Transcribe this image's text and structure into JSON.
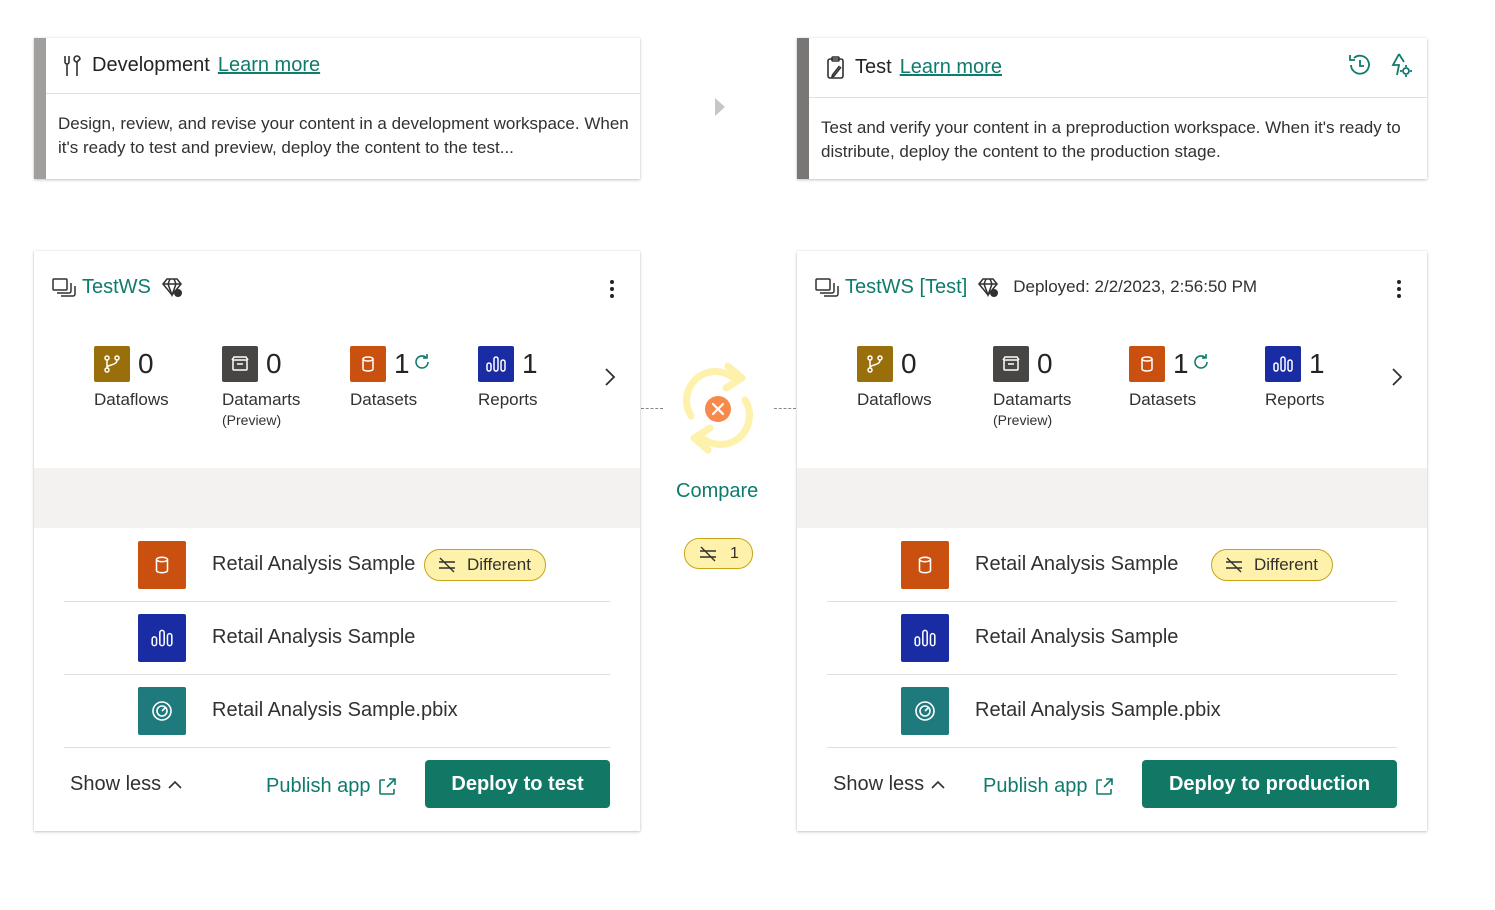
{
  "stages": {
    "dev": {
      "title": "Development",
      "learn_more": "Learn more",
      "description": "Design, review, and revise your content in a development workspace. When it's ready to test and preview, deploy the content to the test..."
    },
    "test": {
      "title": "Test",
      "learn_more": "Learn more",
      "description": "Test and verify your content in a preproduction workspace. When it's ready to distribute, deploy the content to the production stage.",
      "icons": [
        "history-icon",
        "deployment-rules-icon"
      ]
    }
  },
  "workspaces": {
    "dev": {
      "name": "TestWS",
      "counts": {
        "dataflows": {
          "value": "0",
          "label": "Dataflows"
        },
        "datamarts": {
          "value": "0",
          "label": "Datamarts",
          "sub": "(Preview)"
        },
        "datasets": {
          "value": "1",
          "label": "Datasets"
        },
        "reports": {
          "value": "1",
          "label": "Reports"
        }
      },
      "items": [
        {
          "name": "Retail Analysis Sample",
          "type": "dataset",
          "badge": "Different"
        },
        {
          "name": "Retail Analysis Sample",
          "type": "report"
        },
        {
          "name": "Retail Analysis Sample.pbix",
          "type": "dashboard"
        }
      ],
      "show_less": "Show less",
      "publish_app": "Publish app",
      "deploy": "Deploy to test"
    },
    "test": {
      "name": "TestWS [Test]",
      "deployed": "Deployed: 2/2/2023, 2:56:50 PM",
      "counts": {
        "dataflows": {
          "value": "0",
          "label": "Dataflows"
        },
        "datamarts": {
          "value": "0",
          "label": "Datamarts",
          "sub": "(Preview)"
        },
        "datasets": {
          "value": "1",
          "label": "Datasets"
        },
        "reports": {
          "value": "1",
          "label": "Reports"
        }
      },
      "items": [
        {
          "name": "Retail Analysis Sample",
          "type": "dataset",
          "badge": "Different"
        },
        {
          "name": "Retail Analysis Sample",
          "type": "report"
        },
        {
          "name": "Retail Analysis Sample.pbix",
          "type": "dashboard"
        }
      ],
      "show_less": "Show less",
      "publish_app": "Publish app",
      "deploy": "Deploy to production"
    }
  },
  "compare": {
    "label": "Compare",
    "diff_count": "1"
  },
  "colors": {
    "accent": "#117865",
    "link": "#0f7b6c",
    "dataflow": "#986f0b",
    "datamart": "#484644",
    "dataset": "#ca5010",
    "report": "#1a2ca3",
    "dashboard": "#1f7a7e",
    "badge_bg": "#fdf1ac"
  }
}
